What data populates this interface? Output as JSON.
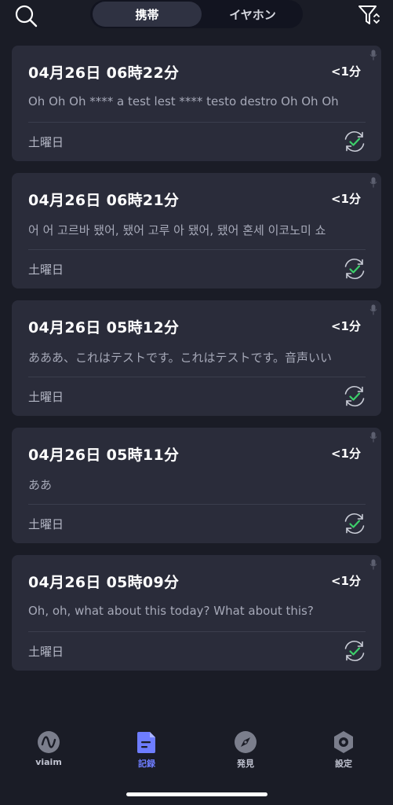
{
  "topbar": {
    "search_icon": "search-icon",
    "tabs": [
      {
        "label": "携帯",
        "active": true
      },
      {
        "label": "イヤホン",
        "active": false
      }
    ],
    "filter_icon": "filter-sort-icon"
  },
  "records": [
    {
      "title": "04月26日 06時22分",
      "duration": "<1分",
      "preview": "Oh Oh Oh **** a test lest **** testo destro Oh Oh Oh",
      "day": "土曜日"
    },
    {
      "title": "04月26日 06時21分",
      "duration": "<1分",
      "preview": "어 어 고르바 됐어, 됐어 고루 아 됐어, 됐어 혼세 이코노미 쇼",
      "day": "土曜日"
    },
    {
      "title": "04月26日 05時12分",
      "duration": "<1分",
      "preview": "あああ、これはテストです。これはテストです。音声いい",
      "day": "土曜日"
    },
    {
      "title": "04月26日 05時11分",
      "duration": "<1分",
      "preview": "ああ",
      "day": "土曜日"
    },
    {
      "title": "04月26日 05時09分",
      "duration": "<1分",
      "preview": "Oh, oh, what about this today? What about this?",
      "day": "土曜日"
    }
  ],
  "tabbar": [
    {
      "label": "viaim",
      "icon": "viaim-logo-icon",
      "active": false
    },
    {
      "label": "記録",
      "icon": "document-icon",
      "active": true
    },
    {
      "label": "発見",
      "icon": "compass-icon",
      "active": false
    },
    {
      "label": "設定",
      "icon": "settings-hex-icon",
      "active": false
    }
  ],
  "colors": {
    "background": "#1a1c26",
    "card": "#2a2c3a",
    "accent": "#6e7dff",
    "sync_check": "#3ccf6a"
  }
}
